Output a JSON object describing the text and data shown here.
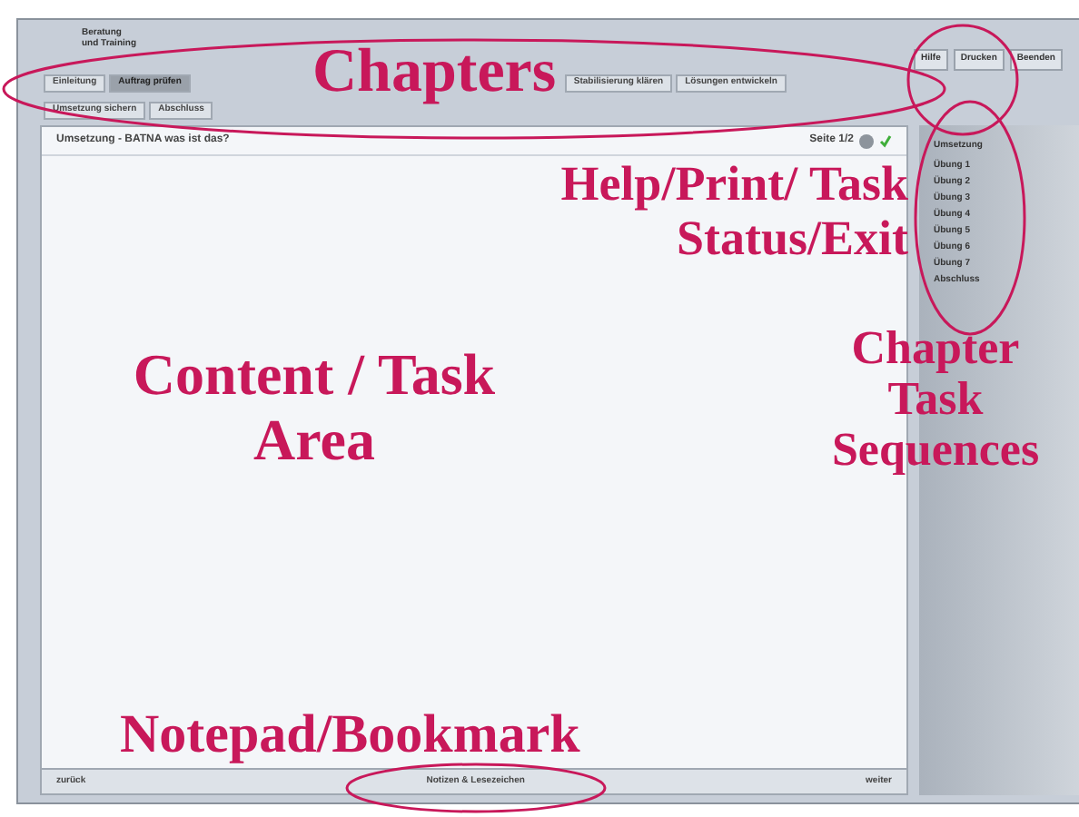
{
  "logo": {
    "line_1": "Beratung",
    "line_2": "und Training"
  },
  "menu": [
    {
      "label": "Hilfe"
    },
    {
      "label": "Drucken"
    },
    {
      "label": "Beenden"
    }
  ],
  "chapters": [
    {
      "label": "Einleitung",
      "selected": false
    },
    {
      "label": "Auftrag prüfen",
      "selected": true
    },
    {
      "label": "Stabilisierung klären",
      "selected": false
    },
    {
      "label": "Lösungen entwickeln",
      "selected": false
    },
    {
      "label": "Umsetzung sichern",
      "selected": false
    },
    {
      "label": "Abschluss",
      "selected": false
    }
  ],
  "content": {
    "breadcrumb": "Umsetzung - BATNA was ist das?",
    "page": "Seite 1/2"
  },
  "sequence": {
    "title": "Umsetzung",
    "items": [
      {
        "label": "Übung 1"
      },
      {
        "label": "Übung 2"
      },
      {
        "label": "Übung 3"
      },
      {
        "label": "Übung 4"
      },
      {
        "label": "Übung 5"
      },
      {
        "label": "Übung 6"
      },
      {
        "label": "Übung 7"
      },
      {
        "label": "Abschluss"
      }
    ]
  },
  "footer": {
    "back": "zurück",
    "notes": "Notizen & Lesezeichen",
    "next": "weiter"
  },
  "annotations": [
    {
      "kind": "chapters",
      "text": "Chapters"
    },
    {
      "kind": "help",
      "text": "Help/Print/ Task Status/Exit"
    },
    {
      "kind": "content",
      "text": "Content / Task Area"
    },
    {
      "kind": "sequence",
      "text": "Chapter Task Sequences"
    },
    {
      "kind": "notepad",
      "text": "Notepad/Bookmark"
    }
  ]
}
